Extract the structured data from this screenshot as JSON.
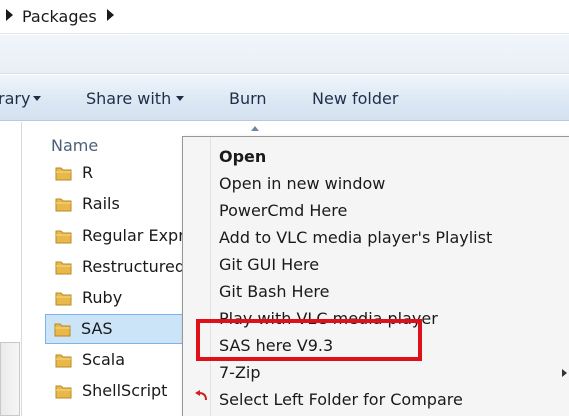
{
  "address_bar": {
    "breadcrumb": "Packages"
  },
  "command_bar": {
    "items": [
      {
        "label": "rary",
        "has_dropdown": true
      },
      {
        "label": "Share with",
        "has_dropdown": true
      },
      {
        "label": "Burn",
        "has_dropdown": false
      },
      {
        "label": "New folder",
        "has_dropdown": false
      }
    ]
  },
  "file_list": {
    "column_header": "Name",
    "items": [
      {
        "label": "R",
        "selected": false
      },
      {
        "label": "Rails",
        "selected": false
      },
      {
        "label": "Regular Expr",
        "selected": false
      },
      {
        "label": "Restructured",
        "selected": false
      },
      {
        "label": "Ruby",
        "selected": false
      },
      {
        "label": "SAS",
        "selected": true
      },
      {
        "label": "Scala",
        "selected": false
      },
      {
        "label": "ShellScript",
        "selected": false
      }
    ]
  },
  "context_menu": {
    "items": [
      {
        "label": "Open",
        "bold": true
      },
      {
        "label": "Open in new window"
      },
      {
        "label": "PowerCmd Here"
      },
      {
        "label": "Add to VLC media player's Playlist"
      },
      {
        "label": "Git GUI Here"
      },
      {
        "label": "Git Bash Here"
      },
      {
        "label": "Play with VLC media player"
      },
      {
        "label": "SAS here V9.3",
        "highlighted": true
      },
      {
        "label": "7-Zip",
        "has_submenu": true
      },
      {
        "label": "Select Left Folder for Compare",
        "icon": "compare-icon"
      }
    ]
  },
  "colors": {
    "selection": "#cce4f7",
    "annotation": "#e0101a",
    "folder": "#e8b84a"
  }
}
